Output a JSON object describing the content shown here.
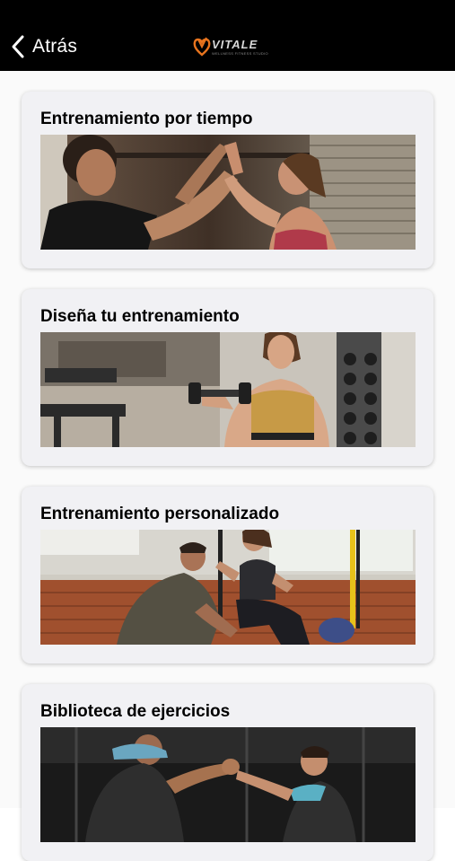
{
  "header": {
    "back_label": "Atrás",
    "logo_text": "VITALE",
    "logo_subtitle": "WELLNESS FITNESS STUDIO",
    "accent": "#e8741e"
  },
  "cards": [
    {
      "title": "Entrenamiento por tiempo",
      "image": "couple-high-five-gym-photo"
    },
    {
      "title": "Diseña tu entrenamiento",
      "image": "woman-lifting-dumbbell-photo"
    },
    {
      "title": "Entrenamiento personalizado",
      "image": "trainer-assisting-squat-photo"
    },
    {
      "title": "Biblioteca de ejercicios",
      "image": "partners-clasped-hands-photo"
    }
  ]
}
